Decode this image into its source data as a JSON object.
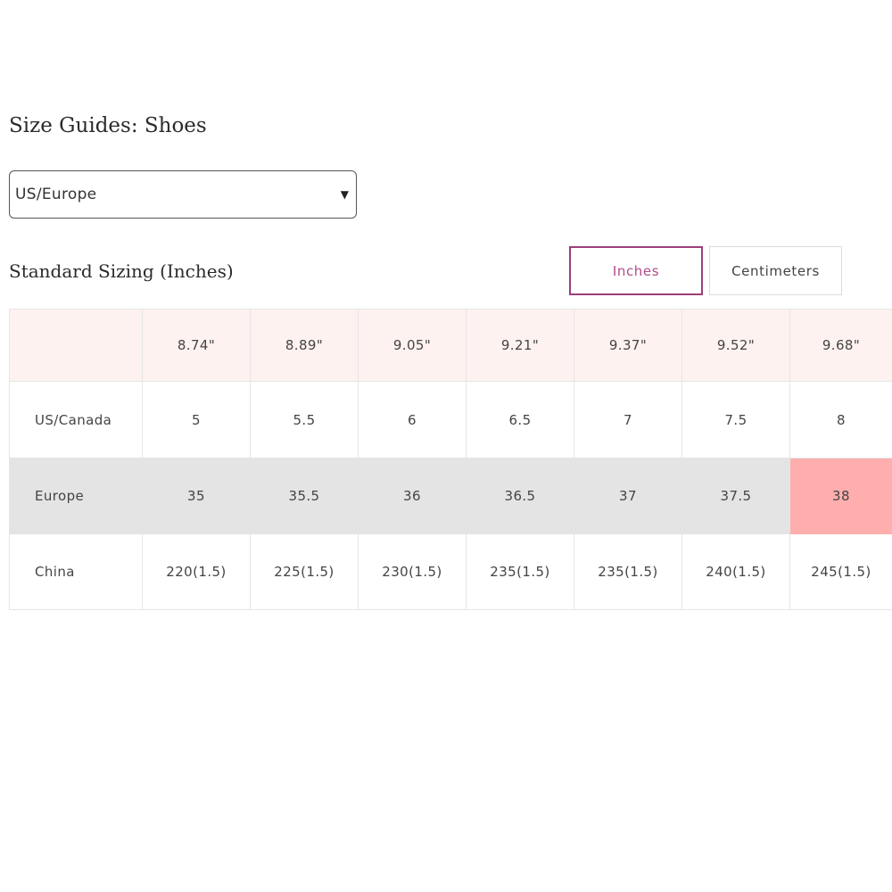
{
  "page": {
    "title": "Size Guides: Shoes"
  },
  "region_select": {
    "value": "US/Europe"
  },
  "sizing": {
    "title": "Standard Sizing (Inches)",
    "units": {
      "inches_label": "Inches",
      "centimeters_label": "Centimeters",
      "active": "Inches"
    }
  },
  "table": {
    "header_label": "",
    "lengths": [
      "8.74\"",
      "8.89\"",
      "9.05\"",
      "9.21\"",
      "9.37\"",
      "9.52\"",
      "9.68\""
    ],
    "rows": [
      {
        "label": "US/Canada",
        "values": [
          "5",
          "5.5",
          "6",
          "6.5",
          "7",
          "7.5",
          "8"
        ]
      },
      {
        "label": "Europe",
        "values": [
          "35",
          "35.5",
          "36",
          "36.5",
          "37",
          "37.5",
          "38"
        ]
      },
      {
        "label": "China",
        "values": [
          "220(1.5)",
          "225(1.5)",
          "230(1.5)",
          "235(1.5)",
          "235(1.5)",
          "240(1.5)",
          "245(1.5)"
        ]
      }
    ],
    "highlighted_cell": {
      "row": "Europe",
      "value": "38"
    }
  },
  "colors": {
    "header_row_bg": "#fdf2f0",
    "europe_row_bg": "#e4e4e4",
    "highlight_bg": "#ffaeae",
    "active_tab_border": "#9c3f78",
    "active_tab_text": "#b04b8a"
  }
}
